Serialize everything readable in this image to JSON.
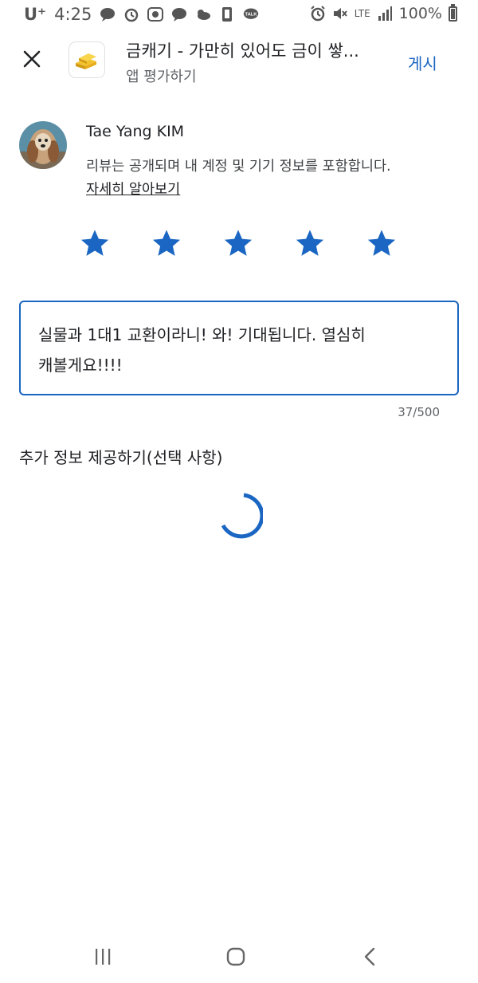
{
  "status_bar": {
    "carrier": "U⁺",
    "time": "4:25",
    "network": "LTE",
    "battery_text": "100%",
    "talk_label": "TALK"
  },
  "app_bar": {
    "title": "금캐기 - 가만히 있어도 금이 쌓...",
    "subtitle": "앱 평가하기",
    "post_label": "게시",
    "app_icon": "gold-bars-icon"
  },
  "user": {
    "name": "Tae Yang KIM",
    "notice": "리뷰는 공개되며 내 계정 및 기기 정보를 포함합니다.",
    "learn_more": "자세히 알아보기"
  },
  "rating": {
    "value": 5,
    "max": 5,
    "star_color": "#1a66c2"
  },
  "review": {
    "line1": "실물과 1대1 교환이라니! 와! 기대됩니다. 열심히",
    "line2": "캐볼게요!!!!",
    "counter": "37/500"
  },
  "extra_info": {
    "label": "추가 정보 제공하기(선택 사항)"
  },
  "colors": {
    "accent": "#1a66c2",
    "text": "#202124",
    "secondary": "#5f6368"
  }
}
